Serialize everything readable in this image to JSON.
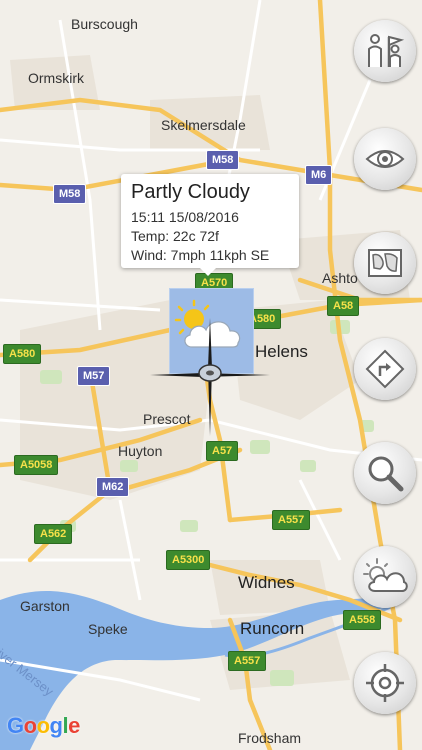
{
  "places": [
    {
      "id": "burscough",
      "name": "Burscough"
    },
    {
      "id": "ormskirk",
      "name": "Ormskirk"
    },
    {
      "id": "skelmersdale",
      "name": "Skelmersdale"
    },
    {
      "id": "helens",
      "name": "Helens"
    },
    {
      "id": "prescot",
      "name": "Prescot"
    },
    {
      "id": "huyton",
      "name": "Huyton"
    },
    {
      "id": "widnes",
      "name": "Widnes"
    },
    {
      "id": "garston",
      "name": "Garston"
    },
    {
      "id": "speke",
      "name": "Speke"
    },
    {
      "id": "runcorn",
      "name": "Runcorn"
    },
    {
      "id": "frodsham",
      "name": "Frodsham"
    },
    {
      "id": "ashton",
      "name": "Ashto"
    }
  ],
  "river_label": "River Mersey",
  "roads": [
    "M58",
    "M58",
    "M6",
    "A570",
    "A580",
    "A58",
    "A580",
    "M57",
    "A57",
    "A5058",
    "M62",
    "A562",
    "A557",
    "A5300",
    "A558",
    "A557"
  ],
  "weather_popup": {
    "condition": "Partly Cloudy",
    "time": "15:11 15/08/2016",
    "temp": "Temp: 22c 72f",
    "wind": "Wind:  7mph 11kph SE"
  },
  "controls": [
    {
      "id": "tour",
      "icon": "tour-guide-icon"
    },
    {
      "id": "view",
      "icon": "eye-icon"
    },
    {
      "id": "map",
      "icon": "map-icon"
    },
    {
      "id": "directions",
      "icon": "directions-icon"
    },
    {
      "id": "search",
      "icon": "search-icon"
    },
    {
      "id": "weather",
      "icon": "weather-icon"
    },
    {
      "id": "locate",
      "icon": "locate-icon"
    }
  ],
  "attribution": "Google",
  "colors": {
    "land": "#f2efe9",
    "water": "#8ab4e8",
    "urban": "#e8e2d8",
    "park": "#c6e3b0",
    "major_road": "#f6c55b",
    "minor_road": "#ffffff",
    "motorway_shield": "#5a5fae",
    "a_road_shield": "#3d8a2e"
  }
}
